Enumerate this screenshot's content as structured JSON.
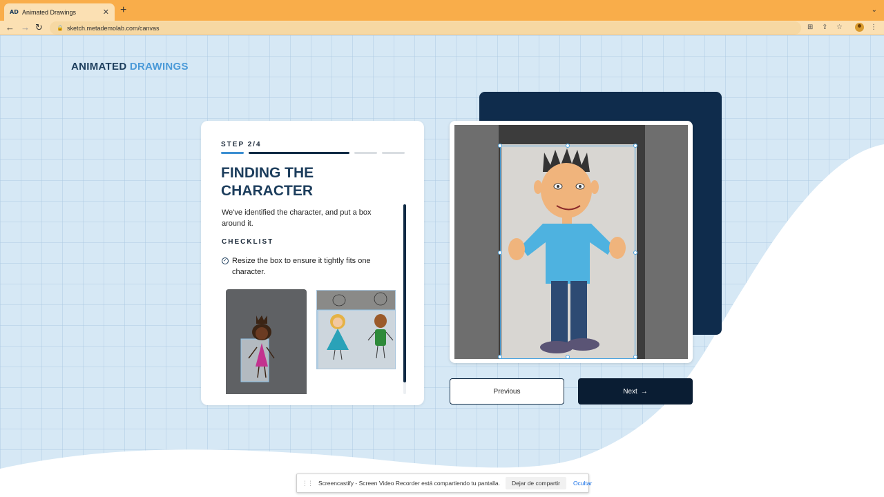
{
  "browser": {
    "tab": {
      "favicon": "AD",
      "title": "Animated Drawings"
    },
    "url": "sketch.metademolab.com/canvas"
  },
  "logo": {
    "part1": "ANIMATED",
    "part2": "DRAWINGS"
  },
  "step": {
    "label": "STEP 2/4",
    "progress": {
      "current": 2,
      "total": 4
    },
    "title": "FINDING THE CHARACTER",
    "description": "We've identified the character, and put a box around it.",
    "checklist_title": "CHECKLIST",
    "checklist_items": [
      "Resize the box to ensure it tightly fits one character."
    ]
  },
  "buttons": {
    "previous": "Previous",
    "next": "Next",
    "next_arrow": "→"
  },
  "share_bar": {
    "message": "Screencastify - Screen Video Recorder está compartiendo tu pantalla.",
    "stop": "Dejar de compartir",
    "hide": "Ocultar"
  },
  "colors": {
    "accent": "#4b9ad8",
    "navy": "#1c3d5c",
    "dark_panel": "#0f2c4c",
    "tab_bar": "#f9ad4a",
    "progress_done": "#3b8ed1",
    "progress_current": "#0f2a44",
    "progress_todo": "#d9dde1"
  }
}
